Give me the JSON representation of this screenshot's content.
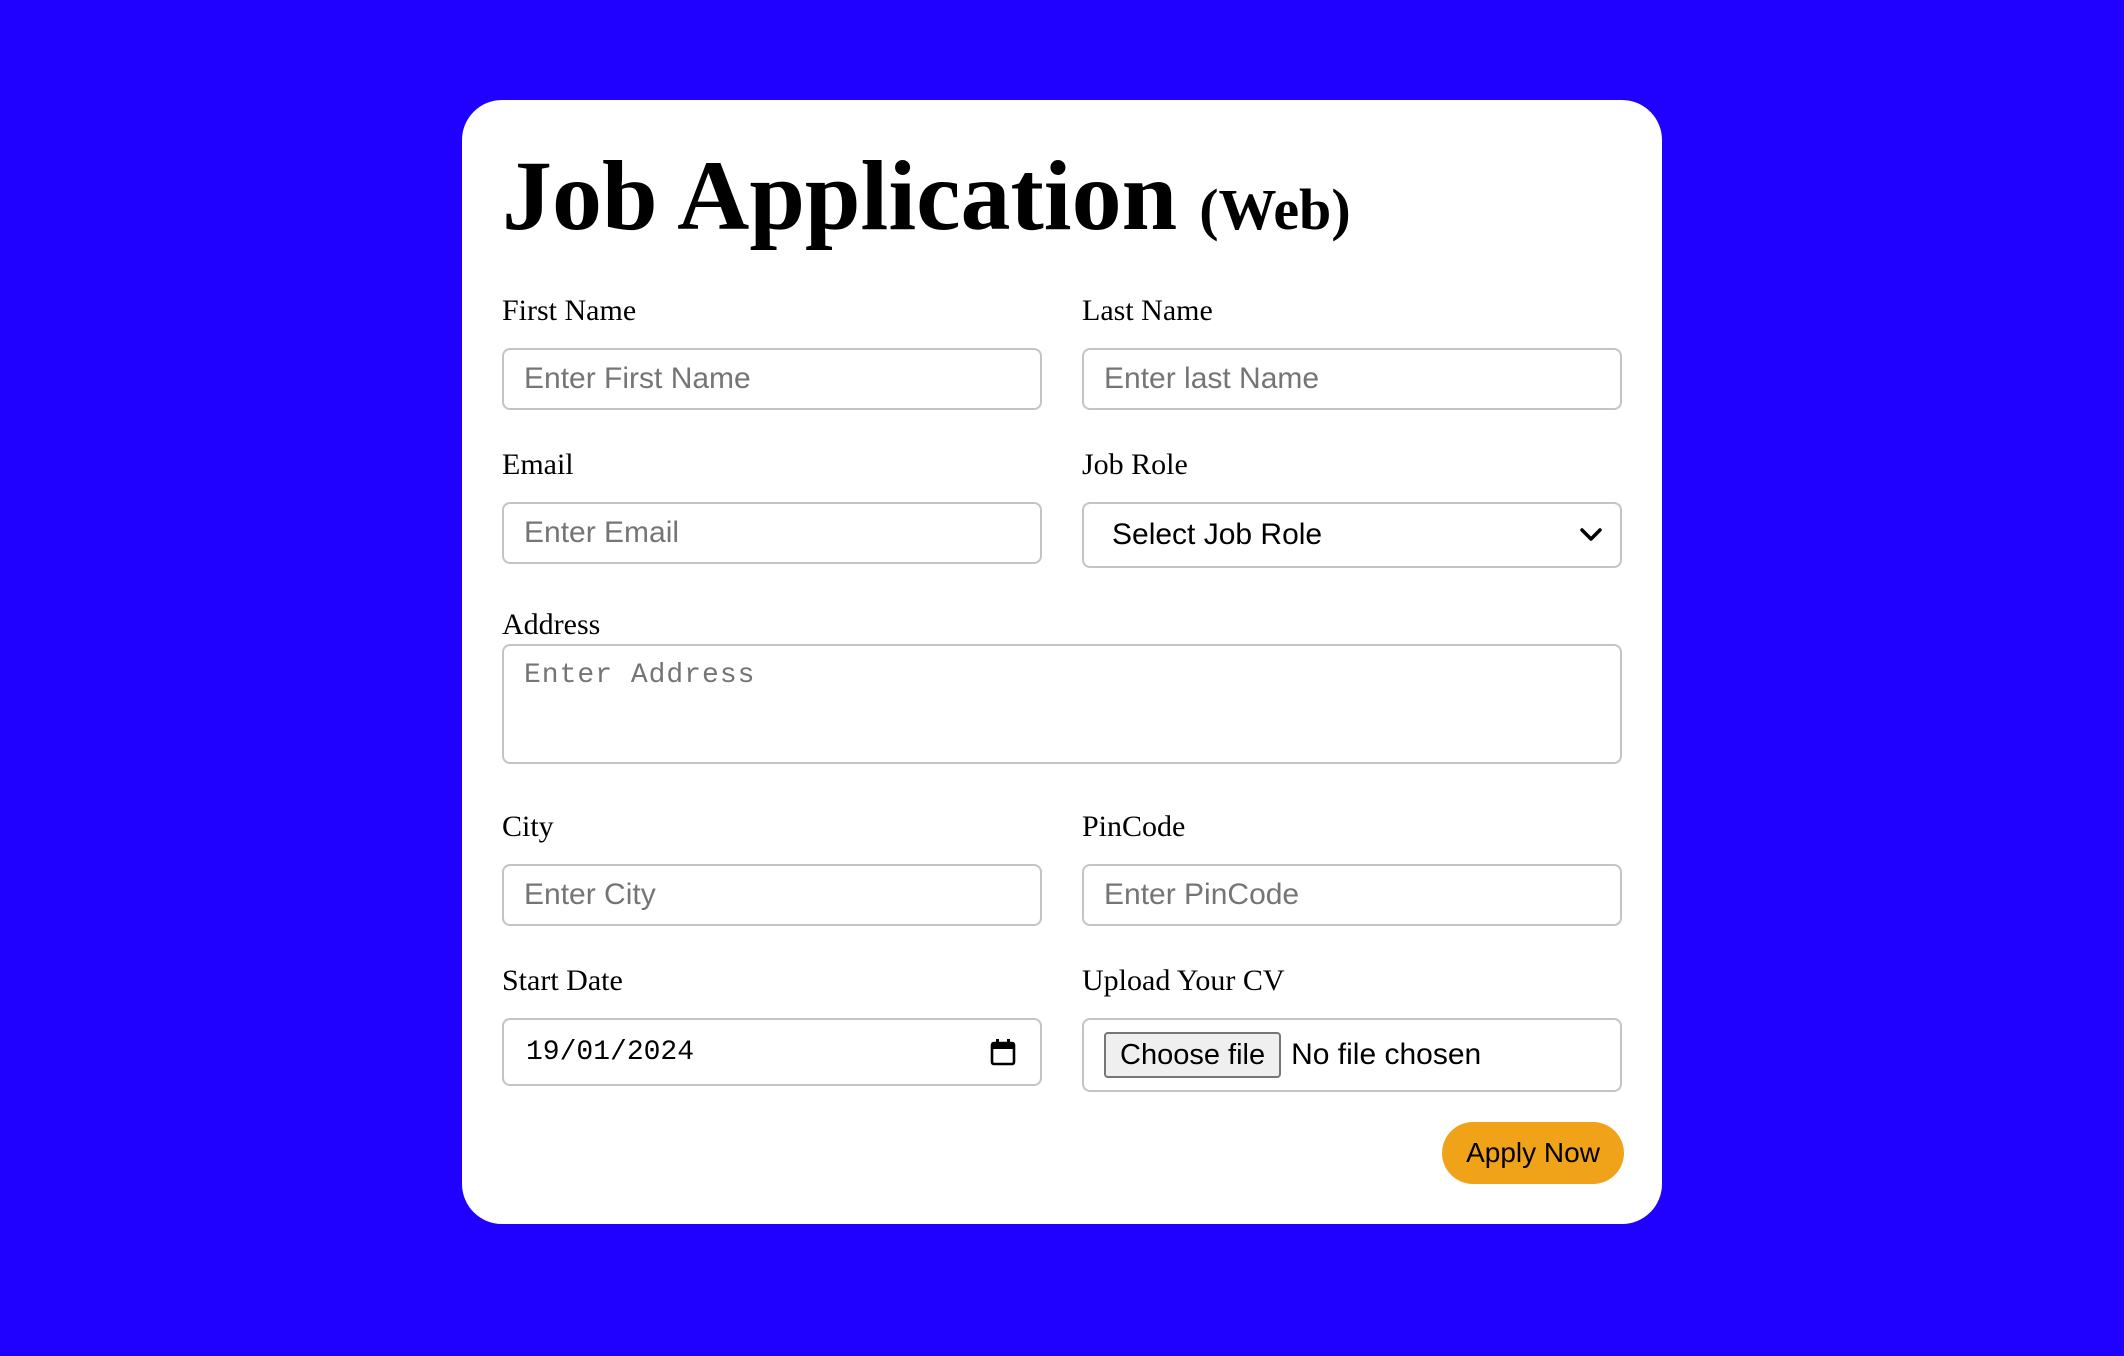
{
  "form": {
    "title": "Job Application",
    "subtitle": "(Web)",
    "first_name": {
      "label": "First Name",
      "placeholder": "Enter First Name"
    },
    "last_name": {
      "label": "Last Name",
      "placeholder": "Enter last Name"
    },
    "email": {
      "label": "Email",
      "placeholder": "Enter Email"
    },
    "job_role": {
      "label": "Job Role",
      "selected": "Select Job Role"
    },
    "address": {
      "label": "Address",
      "placeholder": "Enter Address"
    },
    "city": {
      "label": "City",
      "placeholder": "Enter City"
    },
    "pincode": {
      "label": "PinCode",
      "placeholder": "Enter PinCode"
    },
    "start_date": {
      "label": "Start Date",
      "value": "19/01/2024"
    },
    "cv": {
      "label": "Upload Your CV",
      "button": "Choose file",
      "status": "No file chosen"
    },
    "submit_label": "Apply Now"
  },
  "colors": {
    "background": "#2000ff",
    "card": "#ffffff",
    "accent": "#f0a219",
    "border": "#c4c4c4"
  },
  "icons": {
    "select": "chevron-down-icon",
    "date": "calendar-icon"
  }
}
